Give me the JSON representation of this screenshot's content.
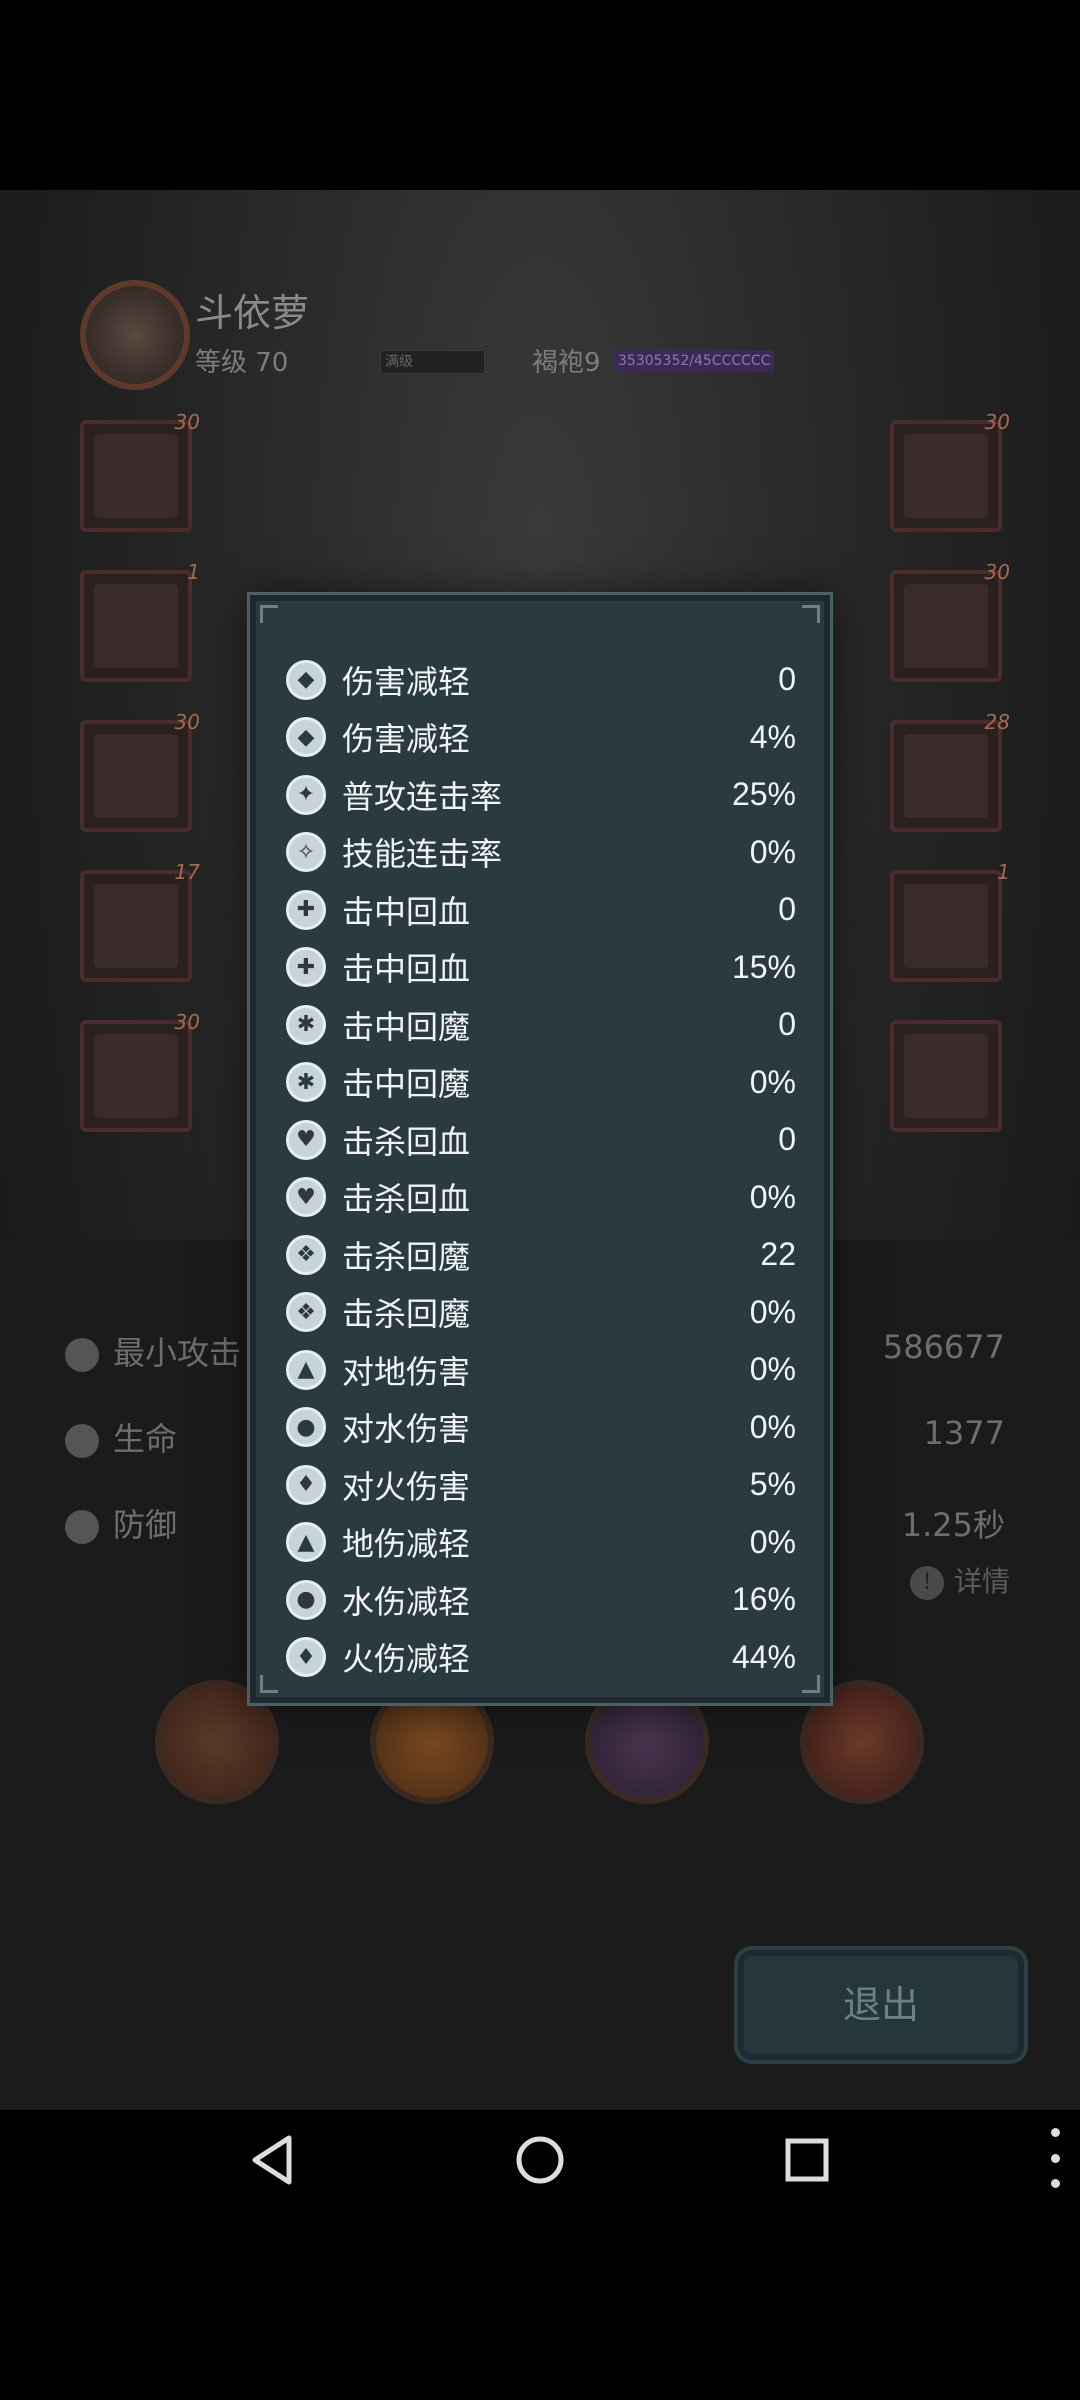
{
  "player": {
    "name": "斗依萝",
    "level_label": "等级 70",
    "xp_label": "满级",
    "title_label": "褐袍9",
    "title_progress": "35305352/45CCCCCC"
  },
  "equipment": {
    "left": [
      {
        "level": "30"
      },
      {
        "level": "1"
      },
      {
        "level": "30"
      },
      {
        "level": "17"
      },
      {
        "level": "30"
      }
    ],
    "right": [
      {
        "level": "30"
      },
      {
        "level": "30"
      },
      {
        "level": "28"
      },
      {
        "level": "1"
      },
      {
        "level": ""
      }
    ]
  },
  "stats": {
    "min_attack_label": "最小攻击",
    "min_attack_value": "586677",
    "hp_label": "生命",
    "hp_value": "1377",
    "defense_label": "防御",
    "defense_value": "1.25秒",
    "detail_label": "详情"
  },
  "exit_label": "退出",
  "attributes": [
    {
      "name": "伤害减轻",
      "value": "0",
      "icon": "shield-icon"
    },
    {
      "name": "伤害减轻",
      "value": "4%",
      "icon": "shield-icon"
    },
    {
      "name": "普攻连击率",
      "value": "25%",
      "icon": "combo-icon"
    },
    {
      "name": "技能连击率",
      "value": "0%",
      "icon": "skill-combo-icon"
    },
    {
      "name": "击中回血",
      "value": "0",
      "icon": "hit-heal-icon"
    },
    {
      "name": "击中回血",
      "value": "15%",
      "icon": "hit-heal-icon"
    },
    {
      "name": "击中回魔",
      "value": "0",
      "icon": "hit-mana-icon"
    },
    {
      "name": "击中回魔",
      "value": "0%",
      "icon": "hit-mana-icon"
    },
    {
      "name": "击杀回血",
      "value": "0",
      "icon": "kill-heal-icon"
    },
    {
      "name": "击杀回血",
      "value": "0%",
      "icon": "kill-heal-icon"
    },
    {
      "name": "击杀回魔",
      "value": "22",
      "icon": "kill-mana-icon"
    },
    {
      "name": "击杀回魔",
      "value": "0%",
      "icon": "kill-mana-icon"
    },
    {
      "name": "对地伤害",
      "value": "0%",
      "icon": "earth-icon"
    },
    {
      "name": "对水伤害",
      "value": "0%",
      "icon": "water-icon"
    },
    {
      "name": "对火伤害",
      "value": "5%",
      "icon": "fire-icon"
    },
    {
      "name": "地伤减轻",
      "value": "0%",
      "icon": "earth-resist-icon"
    },
    {
      "name": "水伤减轻",
      "value": "16%",
      "icon": "water-resist-icon"
    },
    {
      "name": "火伤减轻",
      "value": "44%",
      "icon": "fire-resist-icon"
    }
  ]
}
